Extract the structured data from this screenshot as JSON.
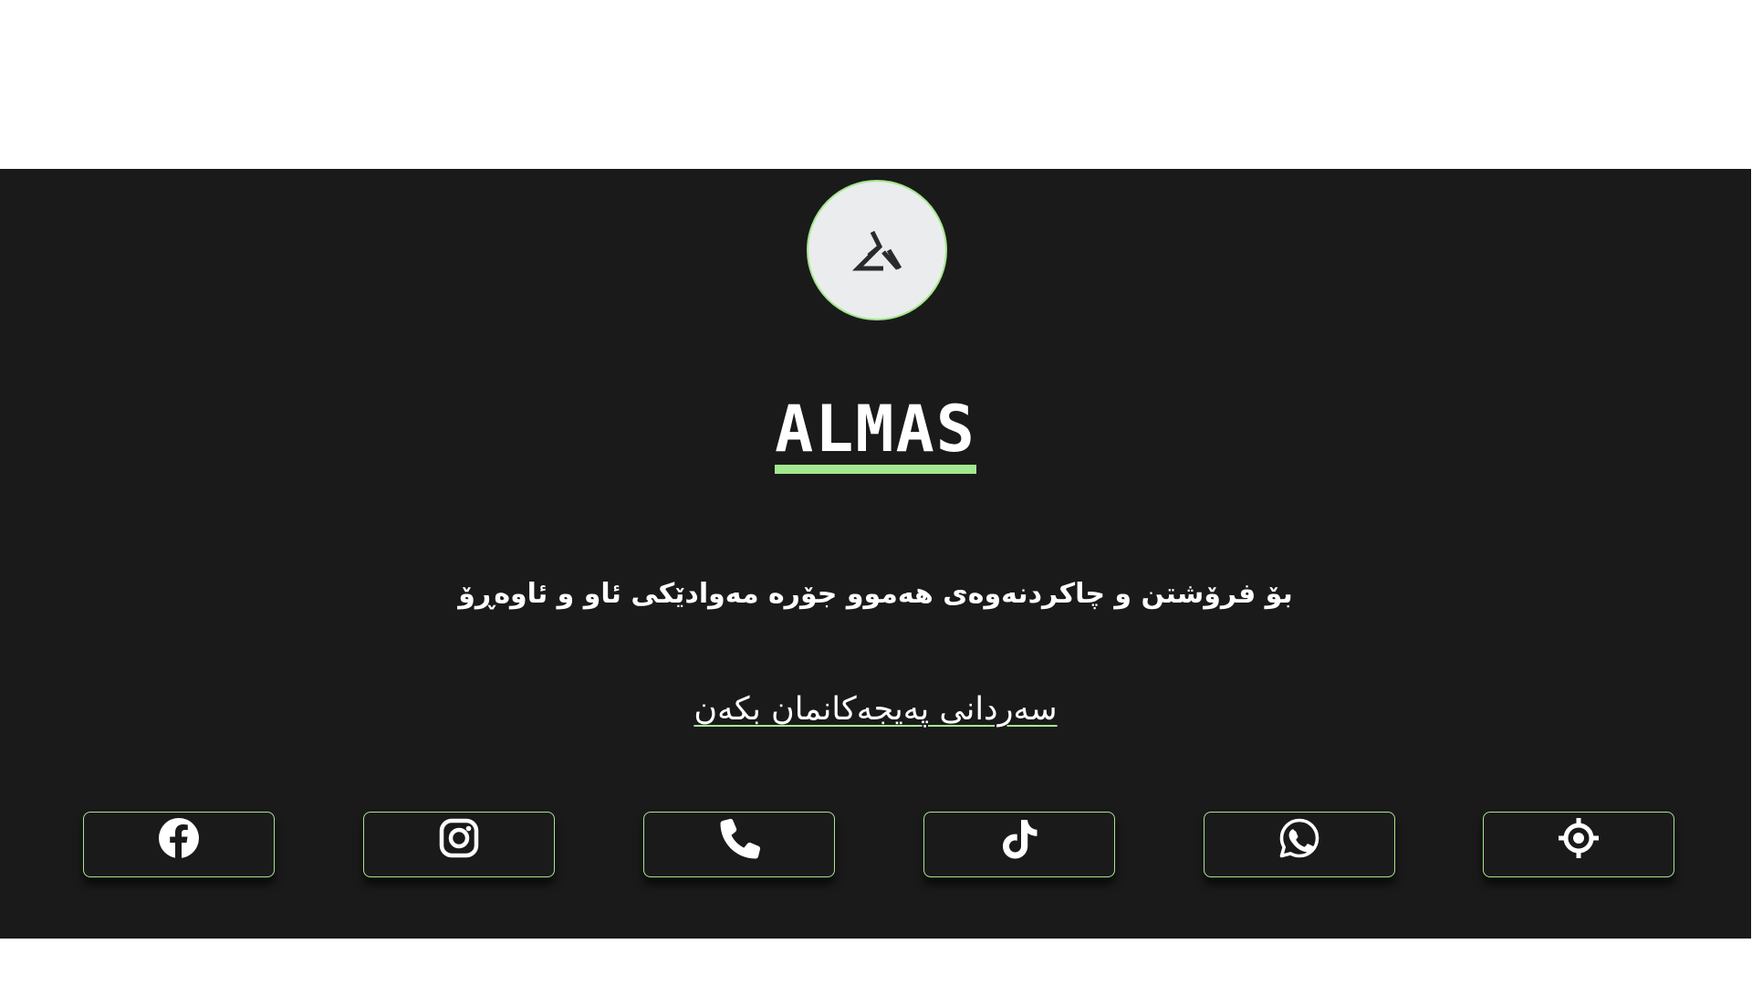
{
  "brand": {
    "logo_icon": "almas-logo-icon",
    "name": "ALMAS"
  },
  "tagline": "بۆ فرۆشتن و چاکردنەوەی هەموو جۆرە مەوادێکی ئاو و ئاوەڕۆ",
  "visit_link": "سەردانی پەیجەکانمان بکەن",
  "social_buttons": [
    {
      "icon": "facebook-icon"
    },
    {
      "icon": "instagram-icon"
    },
    {
      "icon": "phone-icon"
    },
    {
      "icon": "tiktok-icon"
    },
    {
      "icon": "whatsapp-icon"
    },
    {
      "icon": "location-icon"
    }
  ],
  "colors": {
    "accent": "#a3e88e",
    "background": "#1b1a1b",
    "logo_bg": "#ebeced",
    "text": "#ffffff"
  }
}
